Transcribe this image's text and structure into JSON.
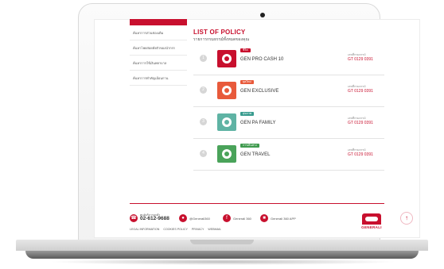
{
  "sidebar": {
    "items": [
      {
        "label": ""
      },
      {
        "label": "ค้นหาการส่วนช่องเดิม"
      },
      {
        "label": "ค้นหาโพยส่อยหั่งตัวของนำกรร"
      },
      {
        "label": "ค้นหาการใช้เงินพยาบาล"
      },
      {
        "label": "ค้นหาการทำคัญเอ้อนกาน"
      }
    ]
  },
  "main": {
    "title": "LIST OF POLICY",
    "subtitle": "รายการกรมธรรม์ทั้งหมดของคุณ",
    "policies": [
      {
        "index": "1",
        "badge": "ชีวิต",
        "badge_color": "#c8102e",
        "book_color": "#c8102e",
        "name": "GEN PRO CASH 10",
        "label": "เลขที่กรมธรรม์",
        "number": "GT 0129 0391"
      },
      {
        "index": "2",
        "badge": "ยุคใหม่",
        "badge_color": "#e85a3b",
        "book_color": "#e85a3b",
        "name": "GEN EXCLUSIVE",
        "label": "เลขที่กรมธรรม์",
        "number": "GT 0129 0391"
      },
      {
        "index": "3",
        "badge": "สุขภาพ",
        "badge_color": "#3a9c8f",
        "book_color": "#5fb3a4",
        "name": "GEN PA FAMILY",
        "label": "เลขที่กรมธรรม์",
        "number": "GT 0129 0391"
      },
      {
        "index": "4",
        "badge": "การเดินทาง",
        "badge_color": "#3f9a4e",
        "book_color": "#4aa35a",
        "name": "GEN TRAVEL",
        "label": "เลขที่กรมธรรม์",
        "number": "GT 0129 0391"
      }
    ]
  },
  "footer": {
    "phone_label": "ศูนย์บริการลูกค้า",
    "phone": "02-612-9688",
    "socials": [
      {
        "label": "@Generali360"
      },
      {
        "label": "Generali 360"
      },
      {
        "label": "Generali 360 APP"
      }
    ],
    "links": [
      "LEGAL INFORMATION",
      "COOKIES POLICY",
      "PRIVACY",
      "WEBMAIL"
    ],
    "brand": "GENERALI"
  },
  "colors": {
    "accent": "#c8102e"
  }
}
